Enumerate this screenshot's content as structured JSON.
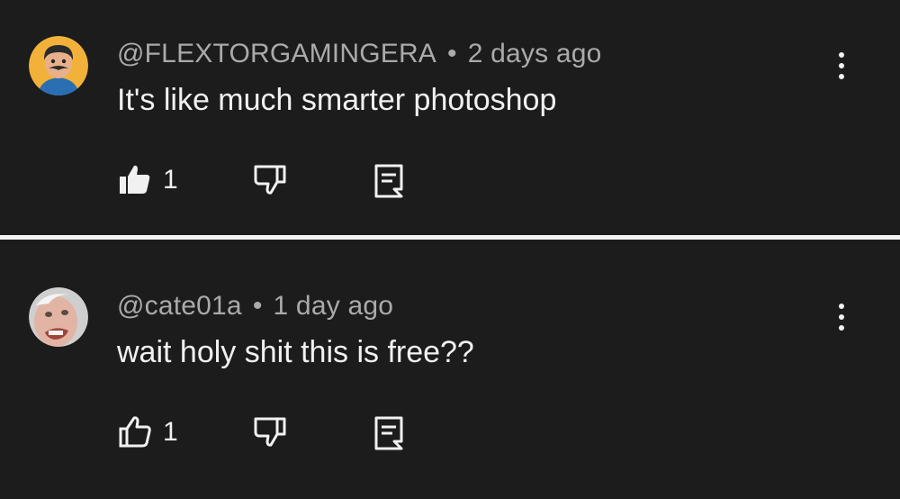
{
  "comments": [
    {
      "author": "@FLEXTORGAMINGERA",
      "separator": "•",
      "time": "2 days ago",
      "text": "It's like much smarter photoshop",
      "likes": "1",
      "liked": true,
      "avatar_colors": {
        "bg": "#f2b23a",
        "skin": "#e7b08a",
        "hair": "#2a2a2a"
      }
    },
    {
      "author": "@cate01a",
      "separator": "•",
      "time": "1 day ago",
      "text": "wait holy shit this is free??",
      "likes": "1",
      "liked": false,
      "avatar_colors": {
        "bg": "#cfcfcf",
        "skin": "#e2b4a4"
      }
    }
  ],
  "icons": {
    "like": "thumbs-up-icon",
    "dislike": "thumbs-down-icon",
    "reply": "reply-icon",
    "more": "kebab-menu-icon"
  },
  "colors": {
    "background": "#1c1c1c",
    "meta_text": "#aaaaaa",
    "body_text": "#f1f1f1",
    "divider": "#f2f2f2"
  }
}
